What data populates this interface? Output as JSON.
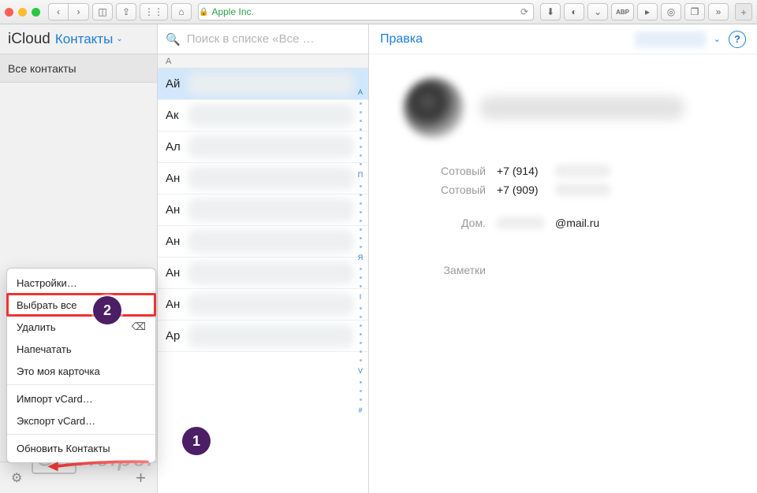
{
  "toolbar": {
    "address_text": "Apple Inc."
  },
  "sidebar": {
    "brand": "iCloud",
    "section_label": "Контакты",
    "group": "Все контакты"
  },
  "search": {
    "placeholder": "Поиск в списке «Все …"
  },
  "list": {
    "section_letter": "А",
    "rows": [
      "Ай",
      "Ак",
      "Ал",
      "Ан",
      "Ан",
      "Ан",
      "Ан",
      "Ан",
      "Ар"
    ],
    "index_labels": [
      "А",
      "П",
      "Я",
      "I",
      "V",
      "#"
    ]
  },
  "popup": {
    "items": {
      "prefs": "Настройки…",
      "select_all": "Выбрать все",
      "delete": "Удалить",
      "print": "Напечатать",
      "my_card": "Это моя карточка",
      "import": "Импорт vCard…",
      "export": "Экспорт vCard…",
      "refresh": "Обновить Контакты"
    }
  },
  "detail": {
    "edit_label": "Правка",
    "phones": [
      {
        "label": "Сотовый",
        "number": "+7 (914)"
      },
      {
        "label": "Сотовый",
        "number": "+7 (909)"
      }
    ],
    "email": {
      "label": "Дом.",
      "domain": "@mail.ru"
    },
    "notes_label": "Заметки"
  },
  "annotations": {
    "one": "1",
    "two": "2"
  },
  "watermark": {
    "text1": "OS",
    "text2": "Helper"
  }
}
